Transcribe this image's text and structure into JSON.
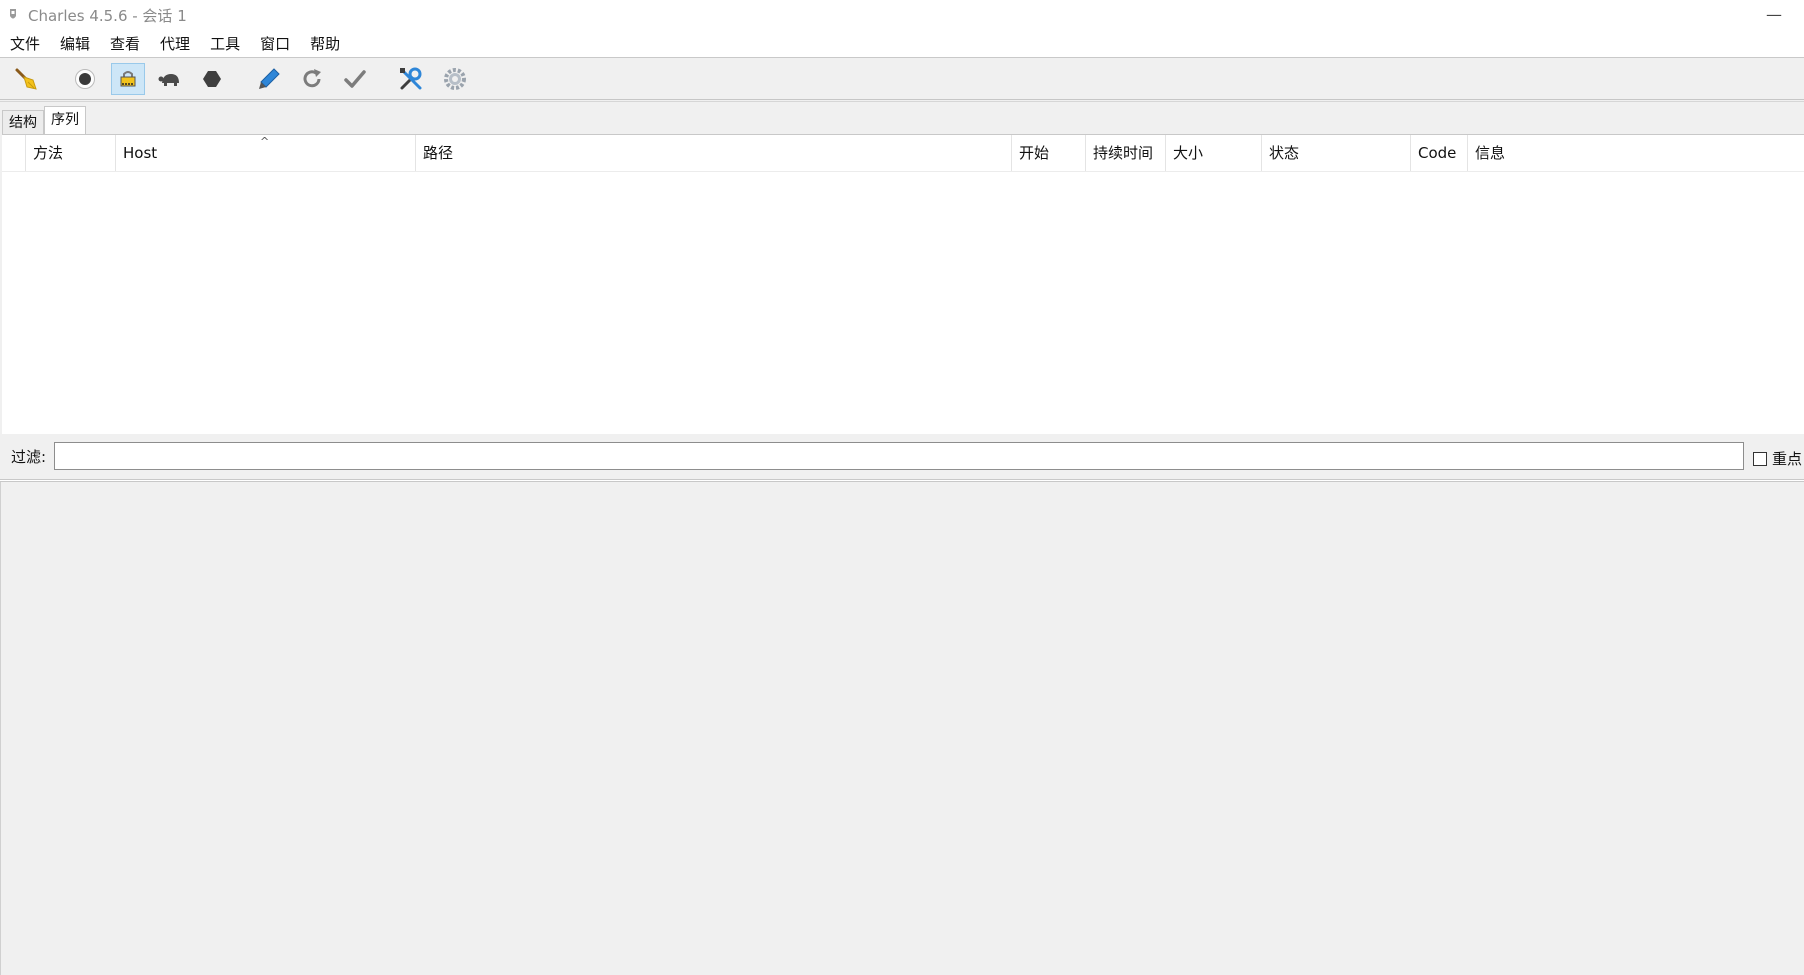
{
  "window": {
    "title": "Charles 4.5.6 - 会话 1",
    "minimize_glyph": "—"
  },
  "menu": {
    "items": [
      "文件",
      "编辑",
      "查看",
      "代理",
      "工具",
      "窗口",
      "帮助"
    ]
  },
  "toolbar": {
    "buttons": [
      {
        "name": "clear-session",
        "icon": "broom-icon",
        "active": false
      },
      {
        "name": "record",
        "icon": "record-icon",
        "active": false
      },
      {
        "name": "ssl-proxying",
        "icon": "ssl-lock-icon",
        "active": true
      },
      {
        "name": "throttle",
        "icon": "turtle-icon",
        "active": false
      },
      {
        "name": "breakpoints",
        "icon": "hexagon-stop-icon",
        "active": false
      },
      {
        "name": "compose",
        "icon": "pen-icon",
        "active": false
      },
      {
        "name": "repeat",
        "icon": "refresh-icon",
        "active": false
      },
      {
        "name": "validate",
        "icon": "checkmark-icon",
        "active": false
      },
      {
        "name": "tools",
        "icon": "tools-icon",
        "active": false
      },
      {
        "name": "settings",
        "icon": "gear-icon",
        "active": false
      }
    ]
  },
  "tabs": [
    "结构",
    "序列"
  ],
  "selected_tab": "序列",
  "table": {
    "columns": [
      "方法",
      "Host",
      "路径",
      "开始",
      "持续时间",
      "大小",
      "状态",
      "Code",
      "信息"
    ],
    "sort_indicator": "^",
    "rows": []
  },
  "filter": {
    "label": "过滤:",
    "value": "",
    "focus_label": "重点"
  }
}
